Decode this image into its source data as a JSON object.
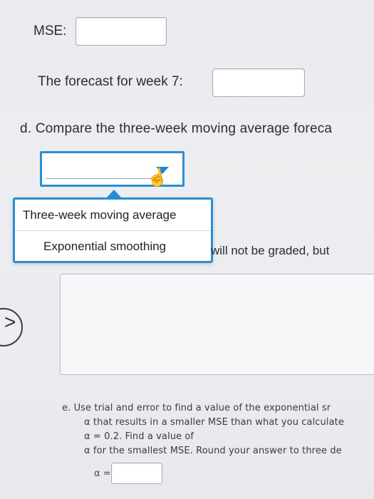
{
  "mse": {
    "label": "MSE:",
    "value": ""
  },
  "forecast_week7": {
    "label": "The forecast for week 7:",
    "value": ""
  },
  "question_d": {
    "text": "d.  Compare the three-week moving average foreca"
  },
  "dropdown": {
    "selected": "",
    "options": [
      "Three-week moving average",
      "Exponential smoothing"
    ]
  },
  "behind_menu_text": "will not be graded, but",
  "answer_area": {
    "value": ""
  },
  "nav": {
    "icon": "chevron-right-icon"
  },
  "question_e": {
    "line1": "e.  Use trial and error to find a value of the exponential sr",
    "line2": "α that results in a smaller MSE than what you calculate",
    "line3": "α = 0.2. Find a value of",
    "line4": "α for the smallest MSE. Round your answer to three de",
    "alpha_label": "α =",
    "alpha_value": ""
  },
  "colors": {
    "accent": "#2a8ed6",
    "background": "#eceef1",
    "text": "#2b2d31"
  }
}
